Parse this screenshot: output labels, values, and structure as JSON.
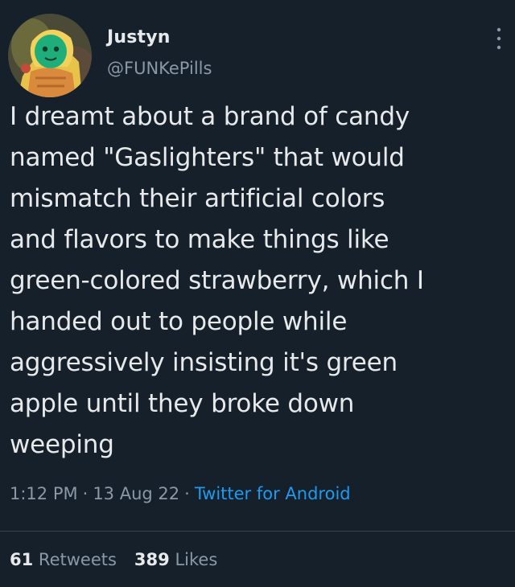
{
  "author": {
    "name": "Justyn",
    "handle": "@FUNKePills"
  },
  "tweet": {
    "text": "I dreamt about a brand of candy\nnamed \"Gaslighters\" that would\nmismatch their artificial colors\nand flavors to make things like\ngreen-colored strawberry, which I\nhanded out to people while\naggressively insisting it's green\napple until they broke down\nweeping",
    "time": "1:12 PM",
    "date": "13 Aug 22",
    "separator": "·",
    "source": "Twitter for Android"
  },
  "stats": {
    "retweets_count": "61",
    "retweets_label": "Retweets",
    "likes_count": "389",
    "likes_label": "Likes"
  },
  "colors": {
    "background": "#15202b",
    "text_primary": "#e7e9ea",
    "text_secondary": "#8b98a5",
    "link": "#1d9bf0",
    "divider": "#38444d"
  },
  "icons": {
    "more": "more-options-icon",
    "avatar": "avatar-illustration"
  }
}
